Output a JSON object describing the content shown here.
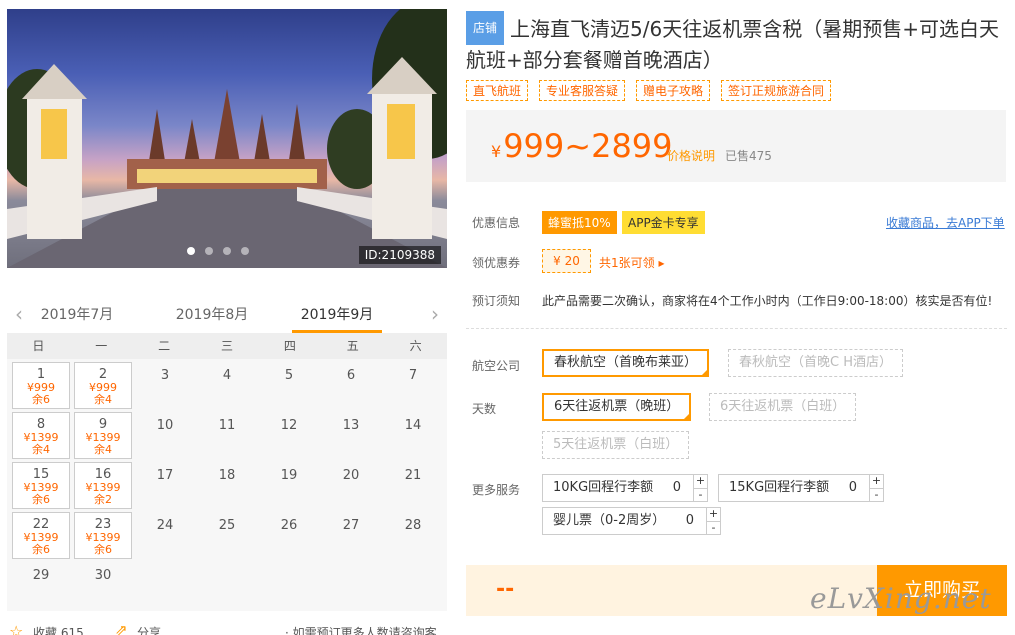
{
  "photo": {
    "id_label": "ID:2109388"
  },
  "calendar": {
    "months": [
      "2019年7月",
      "2019年8月",
      "2019年9月"
    ],
    "weekdays": [
      "日",
      "一",
      "二",
      "三",
      "四",
      "五",
      "六"
    ],
    "avail": [
      {
        "day": "1",
        "price": "¥999",
        "rem": "余6"
      },
      {
        "day": "2",
        "price": "¥999",
        "rem": "余4"
      },
      {
        "day": "8",
        "price": "¥1399",
        "rem": "余4"
      },
      {
        "day": "9",
        "price": "¥1399",
        "rem": "余4"
      },
      {
        "day": "15",
        "price": "¥1399",
        "rem": "余6"
      },
      {
        "day": "16",
        "price": "¥1399",
        "rem": "余2"
      },
      {
        "day": "22",
        "price": "¥1399",
        "rem": "余6"
      },
      {
        "day": "23",
        "price": "¥1399",
        "rem": "余6"
      }
    ],
    "plain": [
      "3",
      "4",
      "5",
      "6",
      "7",
      "10",
      "11",
      "12",
      "13",
      "14",
      "17",
      "18",
      "19",
      "20",
      "21",
      "24",
      "25",
      "26",
      "27",
      "28",
      "29",
      "30"
    ]
  },
  "bottom": {
    "collect": "收藏 615",
    "share": "分享",
    "tip": "· 如需预订更多人数请咨询客服"
  },
  "header": {
    "shop_badge": "店铺",
    "title": "上海直飞清迈5/6天往返机票含税（暑期预售+可选白天航班+部分套餐赠首晚酒店）"
  },
  "tags": [
    "直飞航班",
    "专业客服答疑",
    "赠电子攻略",
    "签订正规旅游合同"
  ],
  "price": {
    "currency": "¥",
    "range": "999~2899",
    "note": "价格说明",
    "sold": "已售475"
  },
  "promo": {
    "label": "优惠信息",
    "badge1": "蜂蜜抵10%",
    "badge2": "APP金卡专享",
    "collect_link": "收藏商品，去APP下单"
  },
  "coupon": {
    "label": "领优惠券",
    "amount": "¥ 20",
    "text": "共1张可领 ▸"
  },
  "notice": {
    "label": "预订须知",
    "text": "此产品需要二次确认，商家将在4个工作小时内（工作日9:00-18:00）核实是否有位!"
  },
  "airline": {
    "label": "航空公司",
    "options": [
      "春秋航空（首晚布莱亚）",
      "春秋航空（首晚C H酒店）"
    ]
  },
  "days": {
    "label": "天数",
    "options": [
      "6天往返机票（晚班）",
      "6天往返机票（白班）",
      "5天往返机票（白班）"
    ]
  },
  "services": {
    "label": "更多服务",
    "items": [
      {
        "name": "10KG回程行李额",
        "qty": "0"
      },
      {
        "name": "15KG回程行李额",
        "qty": "0"
      },
      {
        "name": "婴儿票（0-2周岁）",
        "qty": "0"
      }
    ],
    "plus": "+",
    "minus": "-"
  },
  "buy": {
    "total": "--",
    "button": "立即购买"
  },
  "watermark": "eLvXing.net",
  "colors": {
    "accent": "#ff9900",
    "price": "#ff6600",
    "link": "#3a7bd5",
    "shop_badge": "#5a9ee6"
  }
}
